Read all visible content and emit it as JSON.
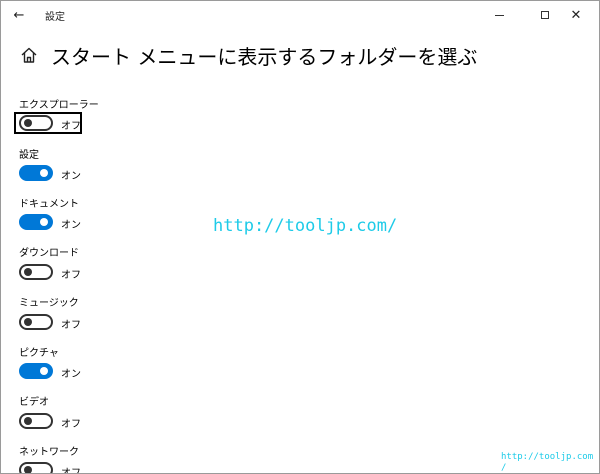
{
  "window": {
    "title": "設定",
    "back_icon": "←",
    "close_icon": "✕"
  },
  "page": {
    "title": "スタート メニューに表示するフォルダーを選ぶ"
  },
  "settings": [
    {
      "label": "エクスプローラー",
      "state": "オフ",
      "on": false
    },
    {
      "label": "設定",
      "state": "オン",
      "on": true
    },
    {
      "label": "ドキュメント",
      "state": "オン",
      "on": true
    },
    {
      "label": "ダウンロード",
      "state": "オフ",
      "on": false
    },
    {
      "label": "ミュージック",
      "state": "オフ",
      "on": false
    },
    {
      "label": "ピクチャ",
      "state": "オン",
      "on": true
    },
    {
      "label": "ビデオ",
      "state": "オフ",
      "on": false
    },
    {
      "label": "ネットワーク",
      "state": "オフ",
      "on": false
    }
  ],
  "watermark": {
    "center": "http://tooljp.com/",
    "corner_line1": "http://tooljp.com",
    "corner_line2": "/"
  },
  "colors": {
    "accent": "#0078d7",
    "watermark": "#1ecbe8"
  }
}
